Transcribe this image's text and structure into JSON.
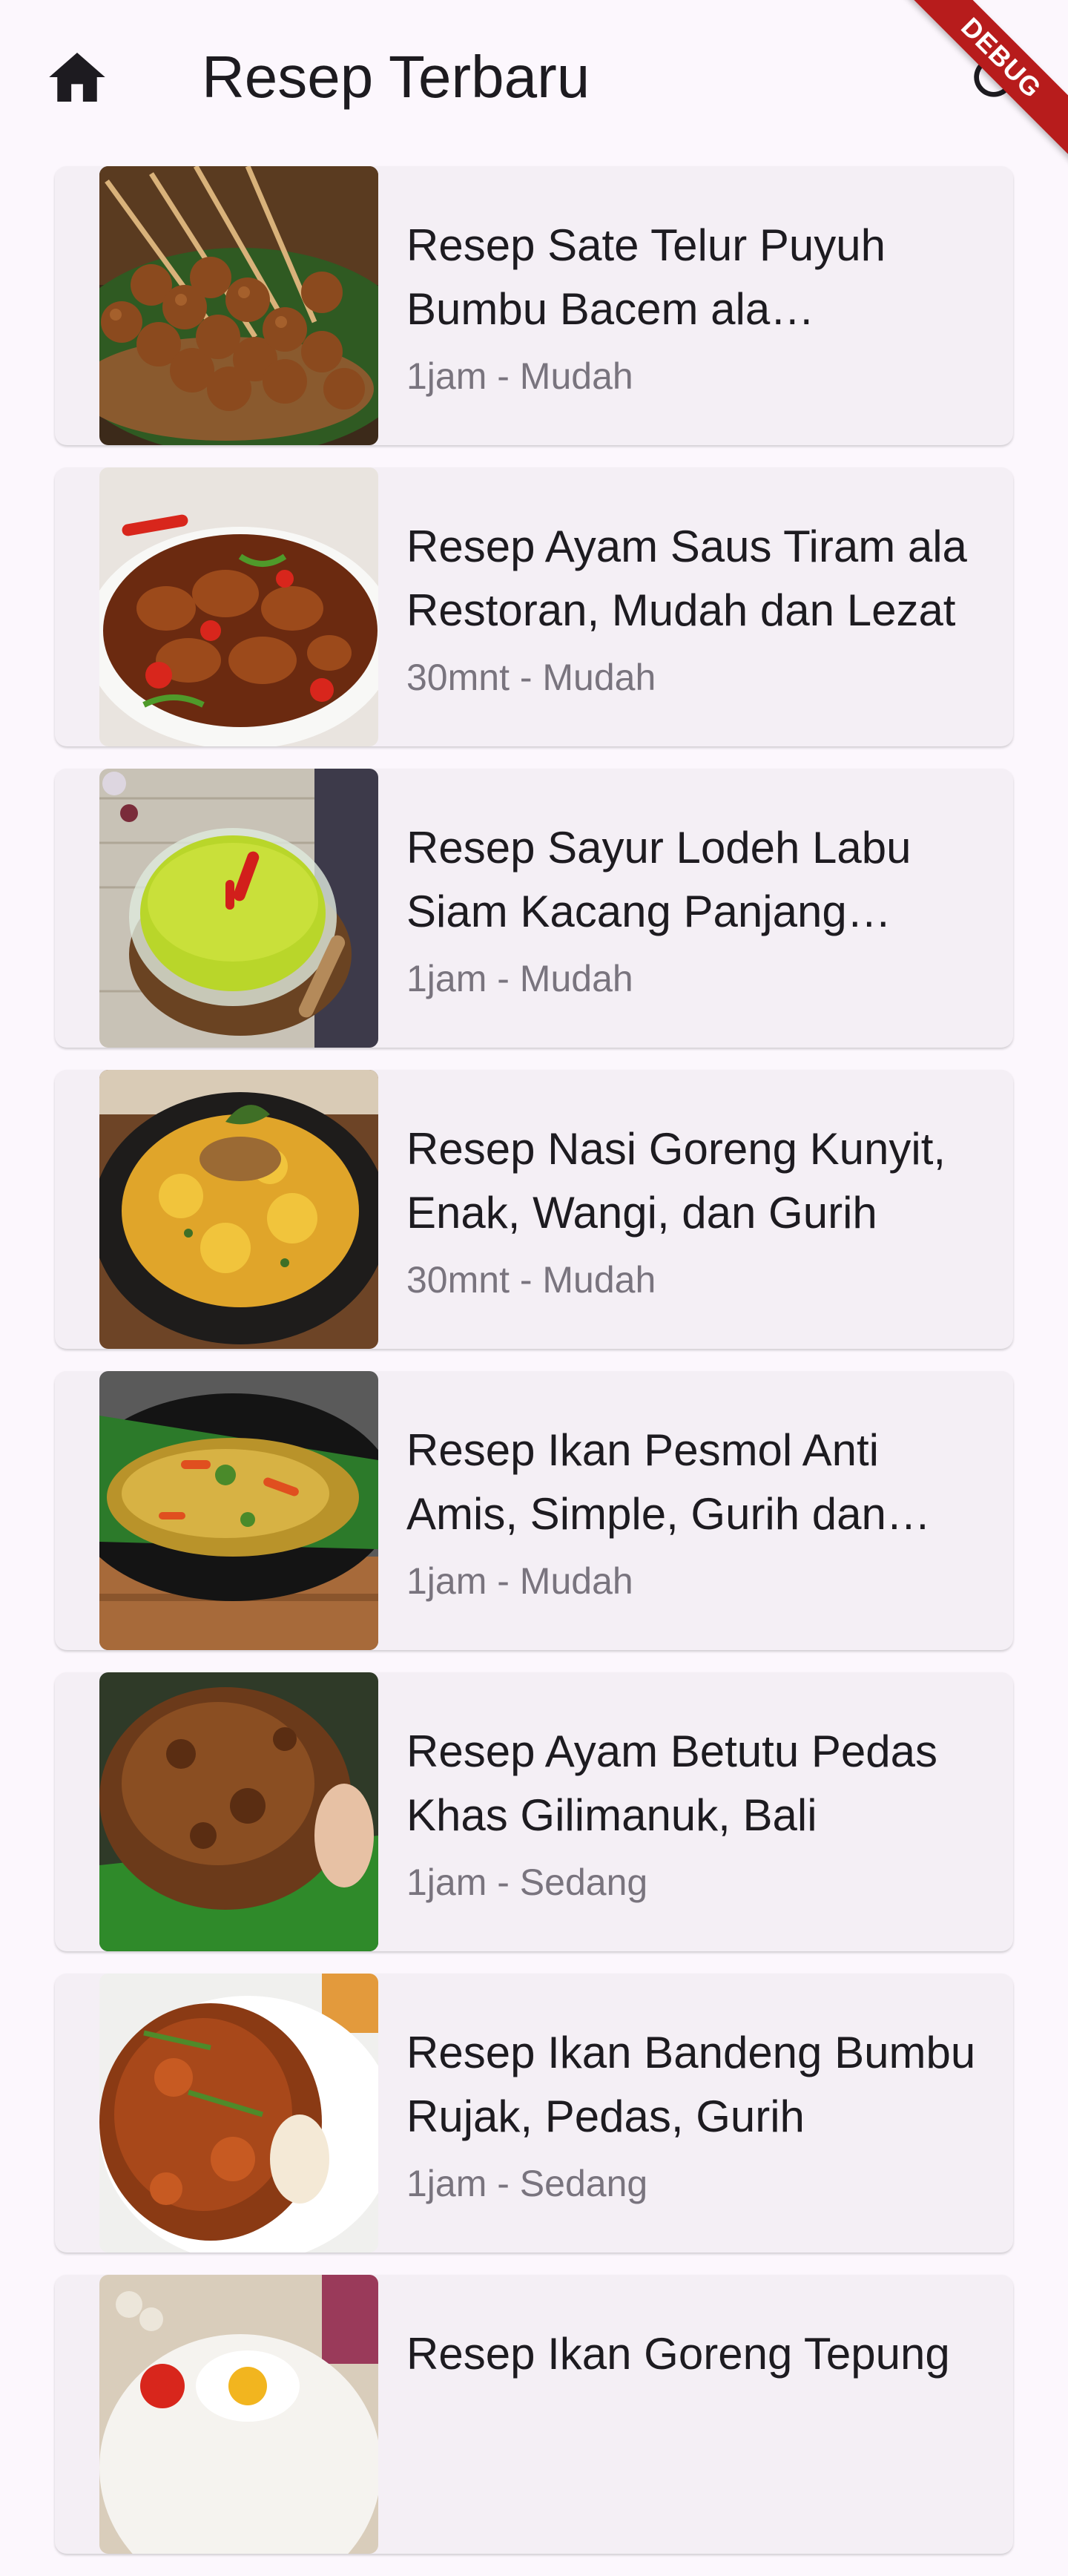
{
  "appbar": {
    "title": "Resep Terbaru",
    "home_icon": "home-icon",
    "refresh_icon": "refresh-icon",
    "debug_label": "DEBUG"
  },
  "recipes": [
    {
      "title": "Resep Sate Telur Puyuh Bumbu Bacem ala Angkringan",
      "meta": "1jam - Mudah",
      "image": "quail-egg-satay"
    },
    {
      "title": "Resep Ayam Saus Tiram ala Restoran, Mudah dan Lezat",
      "meta": "30mnt - Mudah",
      "image": "oyster-sauce-chicken"
    },
    {
      "title": "Resep Sayur Lodeh Labu Siam Kacang Panjang Sederhana",
      "meta": "1jam - Mudah",
      "image": "vegetable-lodeh"
    },
    {
      "title": "Resep Nasi Goreng Kunyit, Enak, Wangi, dan Gurih",
      "meta": "30mnt - Mudah",
      "image": "turmeric-fried-rice"
    },
    {
      "title": "Resep Ikan Pesmol Anti Amis, Simple, Gurih dan Lezat",
      "meta": "1jam - Mudah",
      "image": "fish-pesmol"
    },
    {
      "title": "Resep Ayam Betutu Pedas Khas Gilimanuk, Bali",
      "meta": "1jam - Sedang",
      "image": "ayam-betutu"
    },
    {
      "title": "Resep Ikan Bandeng Bumbu Rujak, Pedas, Gurih",
      "meta": "1jam - Sedang",
      "image": "milkfish-rujak"
    },
    {
      "title": "Resep Ikan Goreng Tepung",
      "meta": "",
      "image": "fried-fish-egg"
    }
  ]
}
